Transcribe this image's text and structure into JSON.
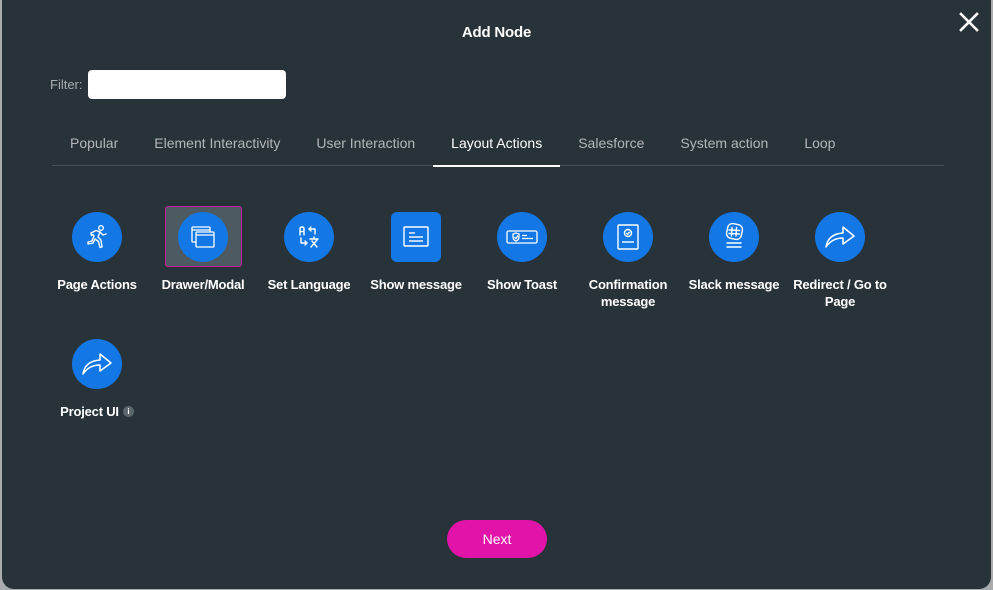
{
  "dialog": {
    "title": "Add Node",
    "close_icon": "close-icon"
  },
  "filter": {
    "label": "Filter:",
    "value": "",
    "placeholder": ""
  },
  "tabs": [
    {
      "label": "Popular",
      "active": false
    },
    {
      "label": "Element Interactivity",
      "active": false
    },
    {
      "label": "User Interaction",
      "active": false
    },
    {
      "label": "Layout Actions",
      "active": true
    },
    {
      "label": "Salesforce",
      "active": false
    },
    {
      "label": "System action",
      "active": false
    },
    {
      "label": "Loop",
      "active": false
    }
  ],
  "nodes": [
    {
      "label": "Page Actions",
      "icon": "running-person-icon",
      "selected": false
    },
    {
      "label": "Drawer/Modal",
      "icon": "windows-icon",
      "selected": true
    },
    {
      "label": "Set Language",
      "icon": "translate-icon",
      "selected": false
    },
    {
      "label": "Show message",
      "icon": "message-box-icon",
      "selected": false
    },
    {
      "label": "Show Toast",
      "icon": "toast-shield-icon",
      "selected": false
    },
    {
      "label": "Confirmation message",
      "icon": "confirmation-icon",
      "selected": false
    },
    {
      "label": "Slack message",
      "icon": "slack-icon",
      "selected": false
    },
    {
      "label": "Redirect / Go to Page",
      "icon": "redirect-arrow-icon",
      "selected": false
    },
    {
      "label": "Project UI",
      "icon": "share-arrow-icon",
      "selected": false,
      "info": "i"
    }
  ],
  "footer": {
    "next_label": "Next"
  },
  "colors": {
    "background": "#283239",
    "icon_blue": "#1477e6",
    "accent_pink": "#e113a8",
    "selected_bg": "#4d5a61"
  }
}
